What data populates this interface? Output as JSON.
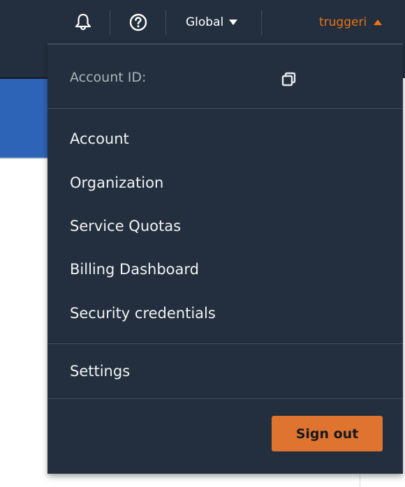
{
  "header": {
    "notifications_icon": "bell-icon",
    "help_icon": "help-circle-icon",
    "region": {
      "label": "Global",
      "icon": "caret-down-icon"
    },
    "user": {
      "label": "truggeri",
      "icon": "caret-up-icon",
      "color": "#ec7211"
    }
  },
  "account_menu": {
    "account_id_label": "Account ID:",
    "account_id_value": "",
    "copy_icon": "copy-icon",
    "items": [
      {
        "label": "Account"
      },
      {
        "label": "Organization"
      },
      {
        "label": "Service Quotas"
      },
      {
        "label": "Billing Dashboard"
      },
      {
        "label": "Security credentials"
      }
    ],
    "settings_label": "Settings",
    "sign_out_label": "Sign out",
    "sign_out_color": "#df7431"
  },
  "colors": {
    "nav_background": "#232f3e",
    "banner": "#2e64b8"
  }
}
